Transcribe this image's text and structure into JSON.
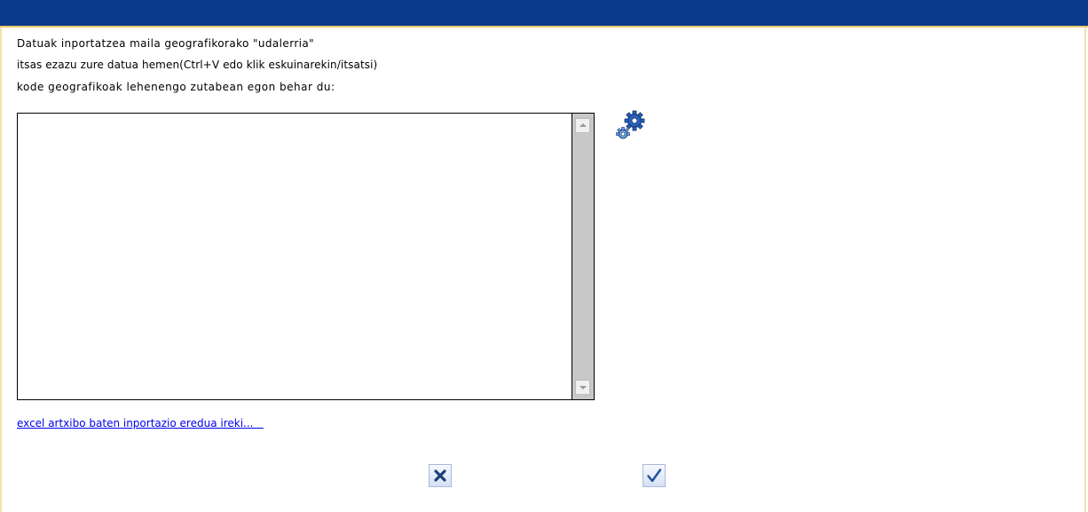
{
  "dialog": {
    "instructions": {
      "line1": "Datuak inportatzea maila geografikorako \"udalerria\"",
      "line2": "itsas ezazu zure datua hemen(Ctrl+V edo klik eskuinarekin/itsatsi)",
      "line3": "kode geografikoak lehenengo zutabean egon behar du:"
    },
    "data_textarea": {
      "value": "",
      "placeholder": ""
    },
    "process_icon": "gear-settings-icon",
    "excel_link_text": "excel artxibo baten inportazio eredua ireki...   ",
    "buttons": {
      "cancel_icon": "close-x-icon",
      "confirm_icon": "checkmark-icon"
    }
  },
  "colors": {
    "titlebar": "#0a3a8c",
    "frame_border": "#f4e0a8",
    "link": "#0000ee",
    "scrollbar_track": "#c8c8c8",
    "icon_blue": "#1f4f9e"
  }
}
